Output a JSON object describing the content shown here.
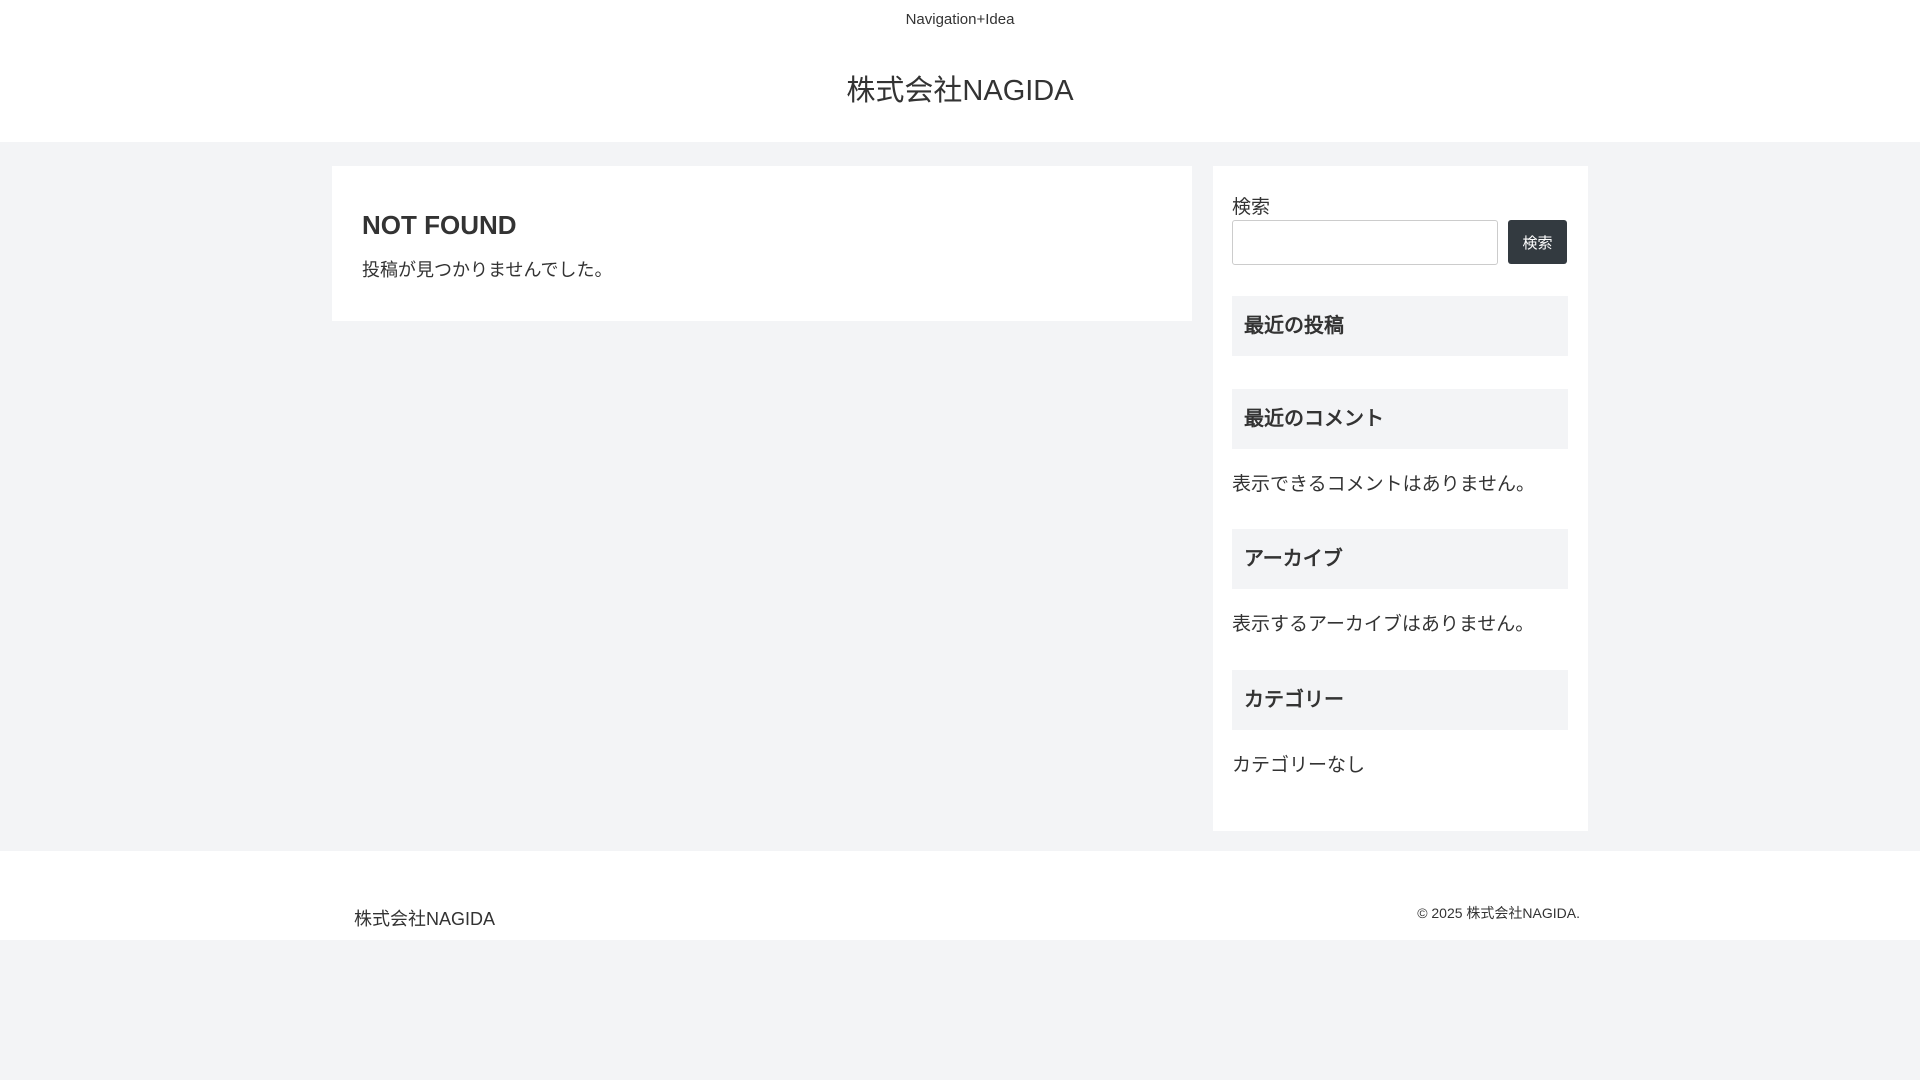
{
  "header": {
    "tagline": "Navigation+Idea",
    "site_title": "株式会社NAGIDA"
  },
  "main": {
    "heading": "NOT FOUND",
    "message": "投稿が見つかりませんでした。"
  },
  "sidebar": {
    "search": {
      "label": "検索",
      "input_value": "",
      "button_label": "検索"
    },
    "widgets": [
      {
        "title": "最近の投稿",
        "text": ""
      },
      {
        "title": "最近のコメント",
        "text": "表示できるコメントはありません。"
      },
      {
        "title": "アーカイブ",
        "text": "表示するアーカイブはありません。"
      },
      {
        "title": "カテゴリー",
        "text": "カテゴリーなし"
      }
    ]
  },
  "footer": {
    "site_title": "株式会社NAGIDA",
    "copyright": "© 2025 株式会社NAGIDA."
  },
  "colors": {
    "page_background": "#f3f4f6",
    "card_background": "#ffffff",
    "text": "#333333",
    "button_background": "#333a40",
    "button_text": "#ffffff"
  }
}
